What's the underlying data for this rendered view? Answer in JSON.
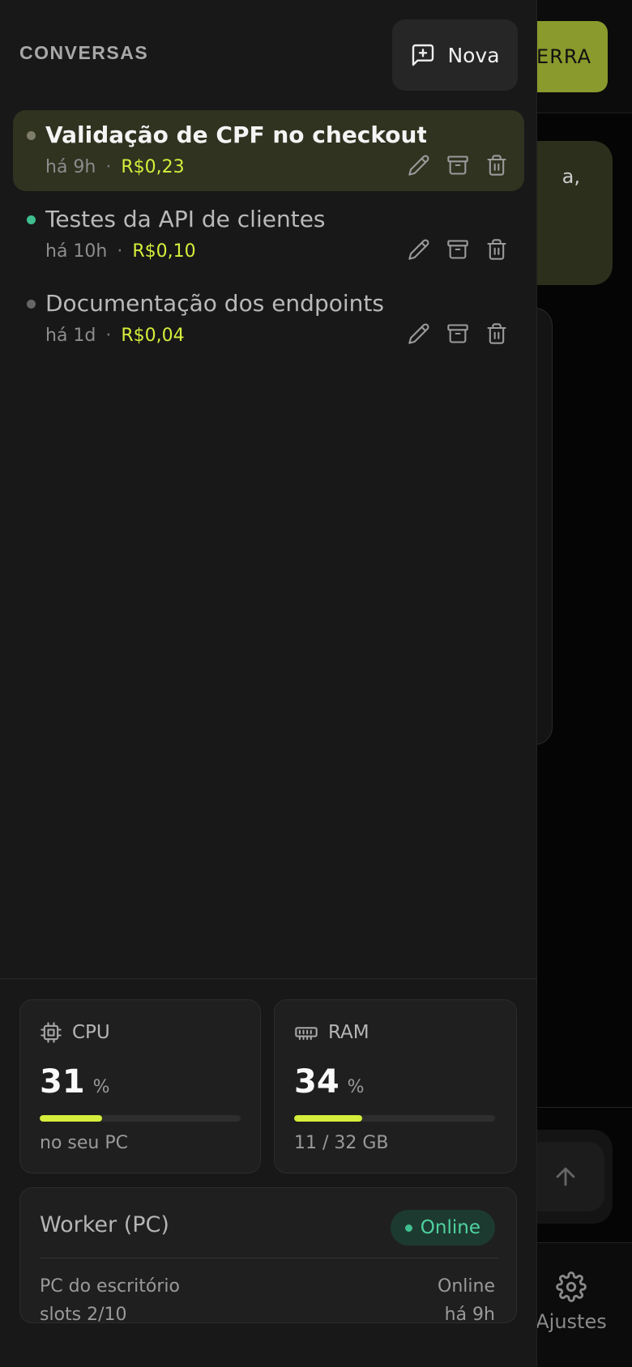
{
  "background": {
    "header_button_label": "ERRA",
    "bubble_text": "a,",
    "nav_label": "Ajustes"
  },
  "drawer": {
    "title": "CONVERSAS",
    "new_button_label": "Nova",
    "conversations": [
      {
        "title": "Validação de CPF no checkout",
        "time": "há 9h",
        "separator": "·",
        "cost": "R$0,23",
        "active": true,
        "dot_color": "#7d7d6a"
      },
      {
        "title": "Testes da API de clientes",
        "time": "há 10h",
        "separator": "·",
        "cost": "R$0,10",
        "active": false,
        "dot_color": "#3fbf8f"
      },
      {
        "title": "Documentação dos endpoints",
        "time": "há 1d",
        "separator": "·",
        "cost": "R$0,04",
        "active": false,
        "dot_color": "#666666"
      }
    ]
  },
  "stats": {
    "cpu": {
      "label": "CPU",
      "value": "31",
      "unit": "%",
      "fraction": 0.31,
      "subtitle": "no seu PC"
    },
    "ram": {
      "label": "RAM",
      "value": "34",
      "unit": "%",
      "fraction": 0.34,
      "subtitle": "11 / 32 GB"
    }
  },
  "worker": {
    "title": "Worker (PC)",
    "status": "Online",
    "machine": "PC do escritório",
    "slots": "slots 2/10",
    "state": "Online",
    "last_seen": "há 9h"
  },
  "colors": {
    "accent": "#d6ee3b",
    "online": "#4fd3a0"
  }
}
